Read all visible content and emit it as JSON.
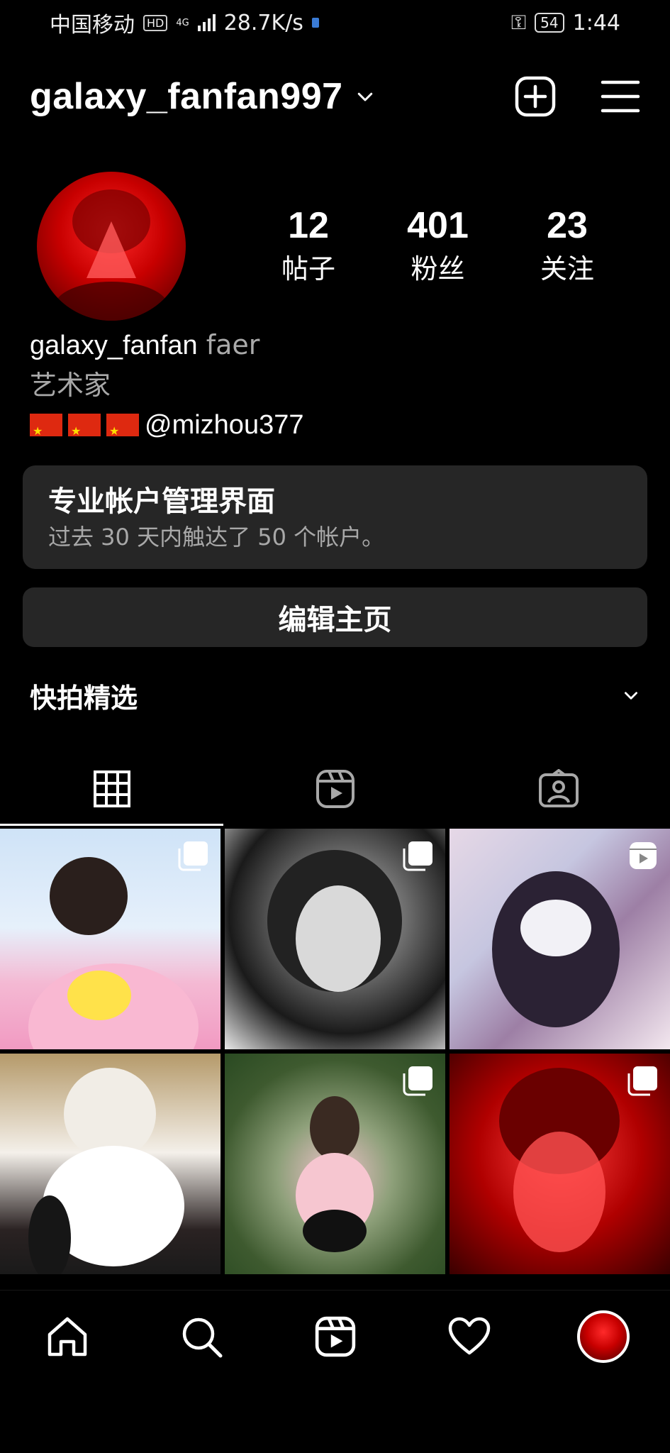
{
  "status_bar": {
    "carrier": "中国移动",
    "hd": "HD",
    "network": "4G",
    "speed": "28.7K/s",
    "battery": "54",
    "time": "1:44"
  },
  "header": {
    "username": "galaxy_fanfan997"
  },
  "stats": [
    {
      "value": "12",
      "label": "帖子"
    },
    {
      "value": "401",
      "label": "粉丝"
    },
    {
      "value": "23",
      "label": "关注"
    }
  ],
  "bio": {
    "name": "galaxy_fanfan",
    "pronouns": "faer",
    "category": "艺术家",
    "mention": "@mizhou377"
  },
  "dashboard": {
    "title": "专业帐户管理界面",
    "subtitle": "过去 30 天内触达了 50 个帐户。"
  },
  "edit_profile_label": "编辑主页",
  "highlights_title": "快拍精选",
  "tabs": [
    {
      "icon": "grid-icon",
      "active": true
    },
    {
      "icon": "reels-icon",
      "active": false
    },
    {
      "icon": "tagged-icon",
      "active": false
    }
  ],
  "posts": [
    {
      "badge": "carousel-icon"
    },
    {
      "badge": "carousel-icon"
    },
    {
      "badge": "reel-icon"
    },
    {
      "badge": "none"
    },
    {
      "badge": "carousel-icon"
    },
    {
      "badge": "carousel-icon"
    }
  ],
  "bottom_nav": [
    "home-icon",
    "search-icon",
    "reels-icon",
    "heart-icon",
    "profile-avatar"
  ],
  "colors": {
    "background": "#000000",
    "card": "#262626",
    "secondary_text": "#a8a8a8",
    "text": "#ffffff"
  }
}
